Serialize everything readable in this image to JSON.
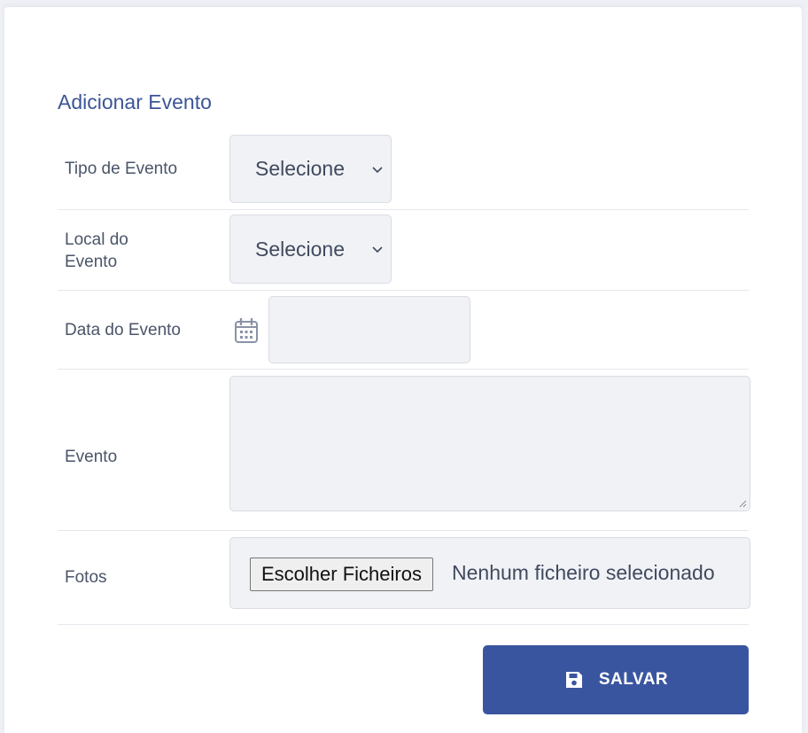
{
  "form": {
    "title": "Adicionar Evento",
    "event_type": {
      "label": "Tipo de Evento",
      "selected": "Selecione"
    },
    "event_location": {
      "label_line1": "Local do",
      "label_line2": "Evento",
      "selected": "Selecione"
    },
    "event_date": {
      "label": "Data do Evento",
      "value": ""
    },
    "event_text": {
      "label": "Evento",
      "value": ""
    },
    "photos": {
      "label": "Fotos",
      "button": "Escolher Ficheiros",
      "status": "Nenhum ficheiro selecionado"
    },
    "save_label": "SALVAR"
  },
  "icons": {
    "date": "calendar-icon",
    "save": "floppy-disk-icon",
    "dropdown": "chevron-down-icon"
  },
  "colors": {
    "accent": "#3a55a0",
    "title": "#3d5596",
    "field_bg": "#f1f2f6",
    "label": "#4a5568"
  }
}
